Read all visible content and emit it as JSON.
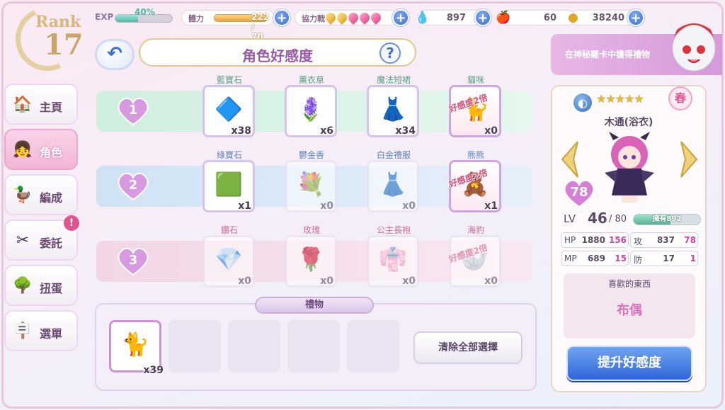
{
  "header": {
    "rank_label": "Rank",
    "rank_value": "17",
    "exp_label": "EXP",
    "exp_percent": "40%",
    "exp_fraction": 0.4,
    "stamina_label": "體力",
    "stamina_value": "222 / 70",
    "coop_label": "協力戰",
    "crystal_value": "897",
    "apple_value": "60",
    "coin_value": "38240",
    "plus_symbol": "+"
  },
  "title": {
    "back_symbol": "↶",
    "text": "角色好感度",
    "help_symbol": "?"
  },
  "banner": {
    "text": "在神秘關卡中獲得禮物"
  },
  "menu": [
    {
      "label": "主頁",
      "icon": "house-icon",
      "glyph": "🏠"
    },
    {
      "label": "角色",
      "icon": "character-icon",
      "glyph": "👧"
    },
    {
      "label": "編成",
      "icon": "duck-icon",
      "glyph": "🦆"
    },
    {
      "label": "委託",
      "icon": "scissors-icon",
      "glyph": "✂"
    },
    {
      "label": "扭蛋",
      "icon": "tree-icon",
      "glyph": "🌳"
    },
    {
      "label": "選單",
      "icon": "signboard-icon",
      "glyph": "🪧"
    }
  ],
  "menu_alert": "!",
  "rows": [
    {
      "num": "1",
      "items": [
        {
          "name": "藍寶石",
          "qty": "x38",
          "icon": "blue-gem-icon",
          "glyph": "🔷",
          "tag": ""
        },
        {
          "name": "薰衣草",
          "qty": "x6",
          "icon": "lavender-icon",
          "glyph": "🪻",
          "tag": ""
        },
        {
          "name": "魔法短裙",
          "qty": "x34",
          "icon": "magic-skirt-icon",
          "glyph": "👗",
          "tag": ""
        },
        {
          "name": "貓咪",
          "qty": "x0",
          "icon": "cat-icon",
          "glyph": "🐈",
          "tag": "好感度2倍"
        }
      ]
    },
    {
      "num": "2",
      "items": [
        {
          "name": "綠寶石",
          "qty": "x1",
          "icon": "green-gem-icon",
          "glyph": "🟩",
          "tag": ""
        },
        {
          "name": "鬱金香",
          "qty": "x0",
          "icon": "tulip-icon",
          "glyph": "💐",
          "tag": ""
        },
        {
          "name": "白金禮服",
          "qty": "x0",
          "icon": "white-dress-icon",
          "glyph": "👗",
          "tag": ""
        },
        {
          "name": "熊熊",
          "qty": "x1",
          "icon": "teddy-bear-icon",
          "glyph": "🧸",
          "tag": "好感度2倍"
        }
      ]
    },
    {
      "num": "3",
      "items": [
        {
          "name": "鑽石",
          "qty": "x0",
          "icon": "diamond-icon",
          "glyph": "💎",
          "tag": ""
        },
        {
          "name": "玫瑰",
          "qty": "x0",
          "icon": "rose-icon",
          "glyph": "🌹",
          "tag": ""
        },
        {
          "name": "公主長袍",
          "qty": "x0",
          "icon": "princess-robe-icon",
          "glyph": "👘",
          "tag": ""
        },
        {
          "name": "海豹",
          "qty": "x0",
          "icon": "seal-plush-icon",
          "glyph": "🦭",
          "tag": "好感度2倍"
        }
      ]
    }
  ],
  "gift": {
    "title": "禮物",
    "selected_qty": "x39",
    "selected_icon": "cat-icon",
    "selected_glyph": "🐈",
    "clear_label": "清除全部選擇"
  },
  "character": {
    "element_glyph": "◐",
    "stars": "★★★★★",
    "season": "春",
    "name": "木通(浴衣)",
    "affinity": "78",
    "lv_label": "LV",
    "lv_value": "46",
    "lv_max": "/ 80",
    "lv_have": "擁有892",
    "lv_fraction": 0.55,
    "stats": {
      "hp_label": "HP",
      "hp_value": "1880",
      "hp_add": "156",
      "atk_label": "攻",
      "atk_value": "837",
      "atk_add": "78",
      "mp_label": "MP",
      "mp_value": "689",
      "mp_add": "15",
      "def_label": "防",
      "def_value": "17",
      "def_add": "1"
    },
    "likes_title": "喜歡的東西",
    "likes_value": "布偶",
    "boost_label": "提升好感度"
  },
  "colors": {
    "accent_blue": "#2f66d6",
    "pink": "#e05290",
    "gold": "#e1b93d"
  }
}
